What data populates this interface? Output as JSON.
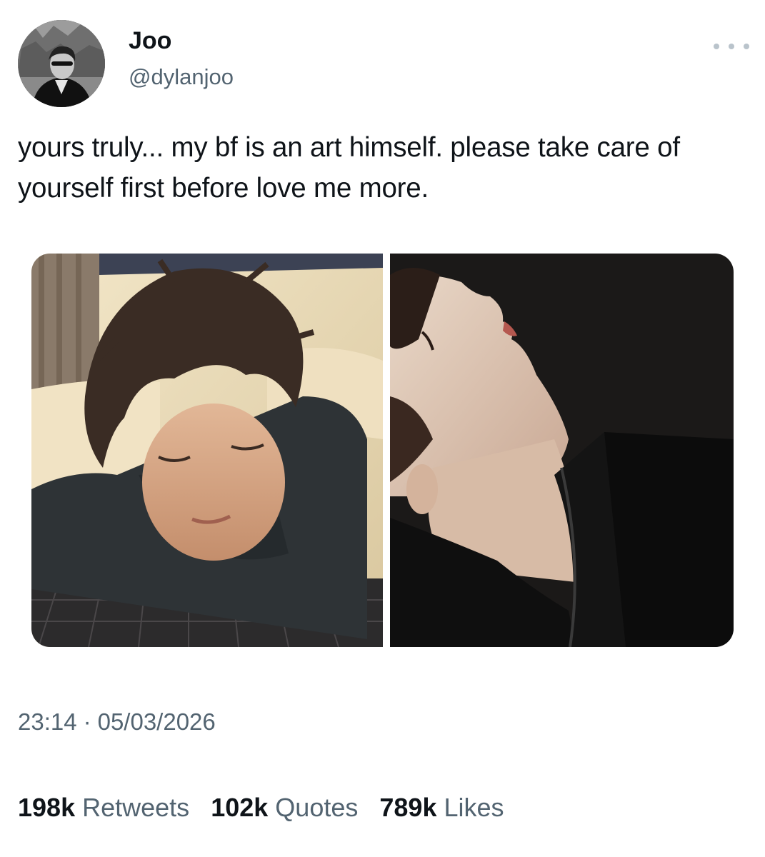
{
  "author": {
    "display_name": "Joo",
    "handle": "@dylanjoo"
  },
  "tweet": {
    "text": "yours truly... my bf is an art himself. please take care of yourself first before love me more.",
    "time": "23:14",
    "separator": "·",
    "date": "05/03/2026"
  },
  "media": [
    {
      "icon": "photo-boy-sleeping-on-leather-couch"
    },
    {
      "icon": "photo-boy-head-tilted-back-dark"
    }
  ],
  "stats": {
    "retweets": {
      "count": "198k",
      "label": "Retweets"
    },
    "quotes": {
      "count": "102k",
      "label": "Quotes"
    },
    "likes": {
      "count": "789k",
      "label": "Likes"
    }
  },
  "colors": {
    "primary_text": "#0f1419",
    "secondary_text": "#536471",
    "background": "#ffffff"
  }
}
